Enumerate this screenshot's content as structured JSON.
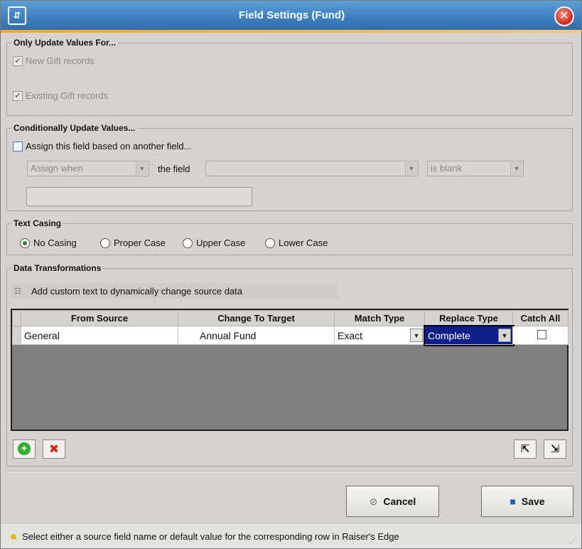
{
  "window": {
    "title": "Field Settings (Fund)",
    "app_icon": "settings-sliders-icon",
    "close_icon": "close-icon"
  },
  "only_update": {
    "legend": "Only Update Values For...",
    "new_gift": {
      "label": "New Gift records",
      "checked": true
    },
    "existing_gift": {
      "label": "Existing Gift records",
      "checked": true
    }
  },
  "conditional": {
    "legend": "Conditionally Update Values...",
    "assign_label": "Assign this field based on another field...",
    "assign_checked": false,
    "assign_when": "Assign when",
    "the_field_label": "the field",
    "field_value": "",
    "condition": "is blank",
    "value_text": ""
  },
  "casing": {
    "legend": "Text Casing",
    "options": [
      "No Casing",
      "Proper Case",
      "Upper Case",
      "Lower Case"
    ],
    "selected": "No Casing"
  },
  "transform": {
    "legend": "Data Transformations",
    "add_custom_text": "Add custom text to dynamically change source data",
    "columns": [
      "From Source",
      "Change To Target",
      "Match Type",
      "Replace Type",
      "Catch All"
    ],
    "rows": [
      {
        "from_source": "General",
        "change_to": "Annual Fund",
        "match_type": "Exact",
        "replace_type": "Complete",
        "catch_all": false
      }
    ]
  },
  "buttons": {
    "cancel": "Cancel",
    "save": "Save"
  },
  "status": {
    "message": "Select either a source field name or default value for the corresponding row in Raiser's Edge"
  }
}
